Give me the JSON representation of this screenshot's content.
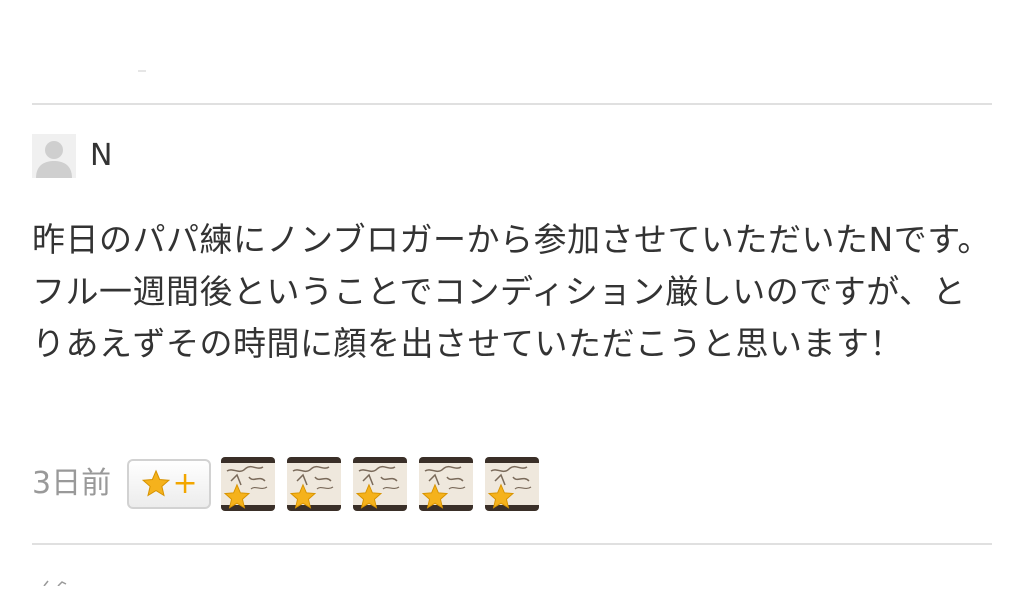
{
  "comment": {
    "username": "N",
    "avatar_icon": "default-user-icon",
    "body": "昨日のパパ練にノンブロガーから参加させていただいたNです。フル一週間後ということでコンディション厳しいのですが、とりあえずその時間に顔を出させていただこうと思います！",
    "timestamp": "3日前",
    "add_star_label": "+",
    "stars": [
      {
        "icon": "star-icon",
        "color": "#f5b21c"
      },
      {
        "icon": "star-icon",
        "color": "#f5b21c"
      },
      {
        "icon": "star-icon",
        "color": "#f5b21c"
      },
      {
        "icon": "star-icon",
        "color": "#f5b21c"
      },
      {
        "icon": "star-icon",
        "color": "#f5b21c"
      }
    ]
  },
  "colors": {
    "star": "#f5b21c",
    "divider": "#e0e0e0",
    "muted_text": "#999999",
    "text": "#333333"
  }
}
